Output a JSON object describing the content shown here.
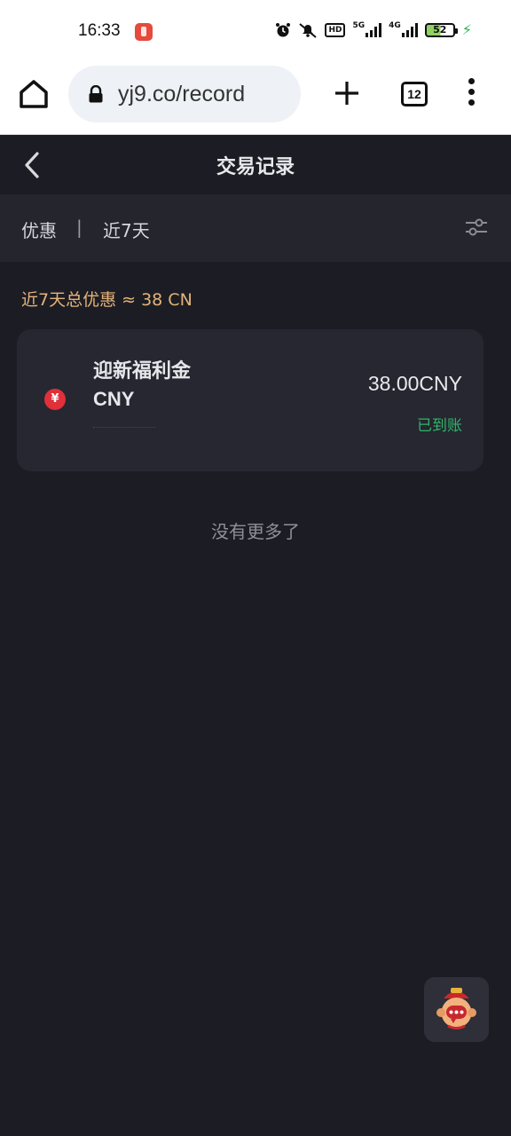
{
  "status_bar": {
    "time": "16:33",
    "network_labels": [
      "5G",
      "4G"
    ],
    "battery_level": "52",
    "icons": [
      "alarm-icon",
      "mute-icon",
      "hd-icon",
      "signal-icon",
      "battery-icon",
      "charging-icon"
    ]
  },
  "browser": {
    "url": "yj9.co/record",
    "tab_count": "12",
    "hd_label": "HD"
  },
  "header": {
    "title": "交易记录"
  },
  "filters": {
    "type_label": "优惠",
    "separator": "|",
    "range_label": "近7天"
  },
  "summary": {
    "text": "近7天总优惠 ≈ 38 CN"
  },
  "records": [
    {
      "icon_symbol": "¥",
      "title": "迎新福利金",
      "currency": "CNY",
      "amount": "38.00CNY",
      "status": "已到账"
    }
  ],
  "footer": {
    "no_more": "没有更多了"
  },
  "colors": {
    "background": "#1c1d24",
    "filter_bar": "#24252d",
    "card": "#262730",
    "summary_accent": "#e6b27a",
    "status_green": "#2fb56a",
    "coin_red": "#e0303a"
  }
}
